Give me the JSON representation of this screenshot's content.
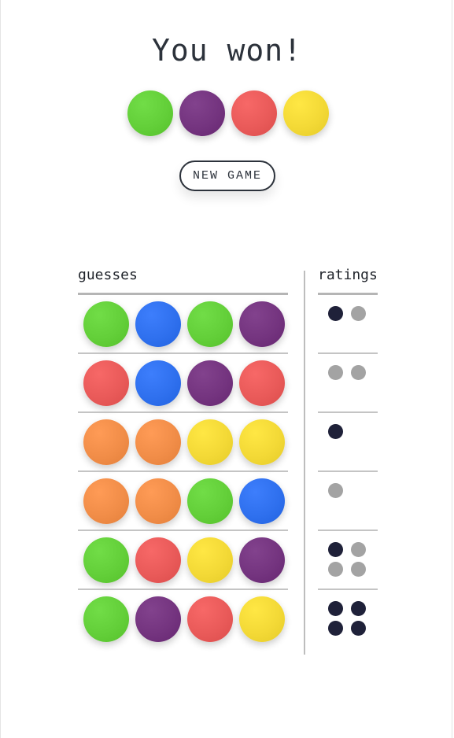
{
  "title": "You won!",
  "new_game_label": "NEW GAME",
  "headers": {
    "guesses": "guesses",
    "ratings": "ratings"
  },
  "colors": {
    "green": "#63cf39",
    "purple": "#74347f",
    "red": "#e95a59",
    "yellow": "#f3d936",
    "blue": "#2f70ee",
    "orange": "#f18d48",
    "black_peg": "#1f2139",
    "white_peg": "#a3a3a3"
  },
  "solution": [
    "green",
    "purple",
    "red",
    "yellow"
  ],
  "guesses": [
    {
      "pegs": [
        "green",
        "blue",
        "green",
        "purple"
      ],
      "rating": [
        "black",
        "white"
      ]
    },
    {
      "pegs": [
        "red",
        "blue",
        "purple",
        "red"
      ],
      "rating": [
        "white",
        "white"
      ]
    },
    {
      "pegs": [
        "orange",
        "orange",
        "yellow",
        "yellow"
      ],
      "rating": [
        "black"
      ]
    },
    {
      "pegs": [
        "orange",
        "orange",
        "green",
        "blue"
      ],
      "rating": [
        "white"
      ]
    },
    {
      "pegs": [
        "green",
        "red",
        "yellow",
        "purple"
      ],
      "rating": [
        "black",
        "white",
        "white",
        "white"
      ]
    },
    {
      "pegs": [
        "green",
        "purple",
        "red",
        "yellow"
      ],
      "rating": [
        "black",
        "black",
        "black",
        "black"
      ]
    }
  ]
}
